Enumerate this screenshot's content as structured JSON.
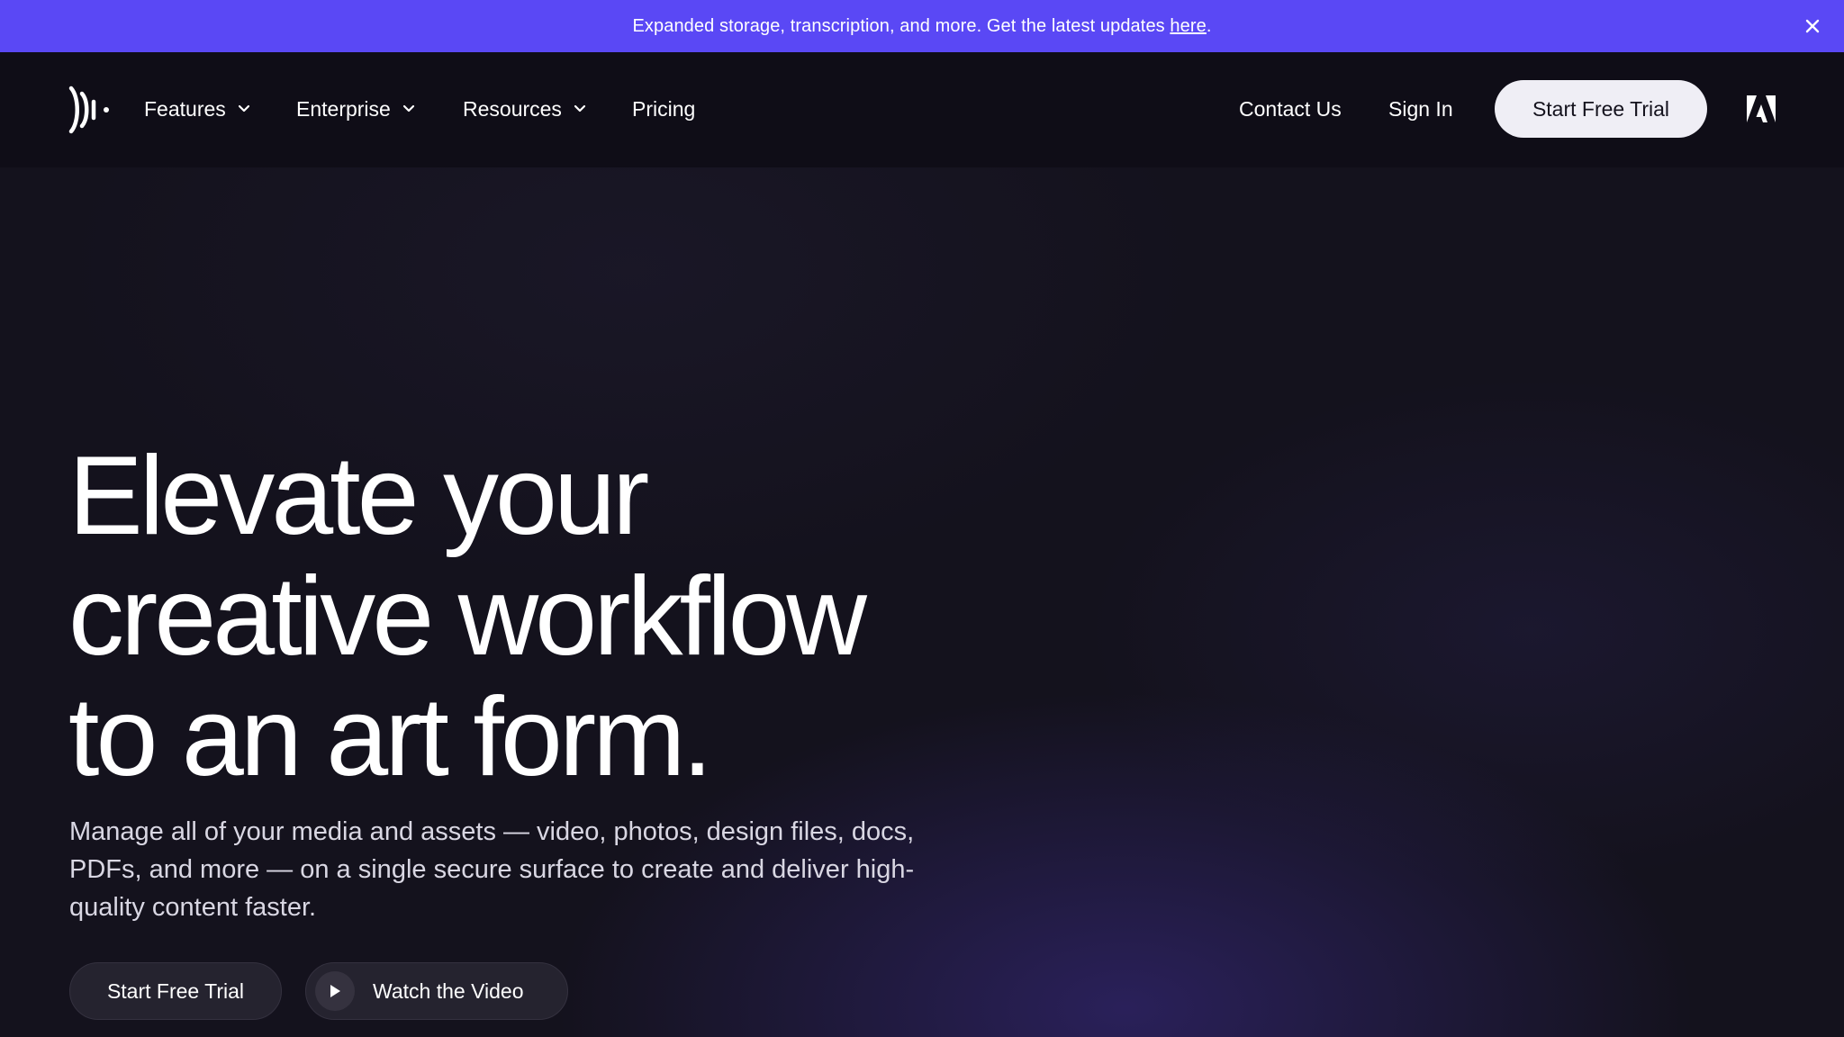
{
  "banner": {
    "message": "Expanded storage, transcription, and more. Get the latest updates ",
    "link_label": "here",
    "suffix": ".",
    "close_icon": "close-icon",
    "background_color": "#5a48f5"
  },
  "nav": {
    "logo_icon": "frameio-logo-icon",
    "items": [
      {
        "label": "Features",
        "has_dropdown": true
      },
      {
        "label": "Enterprise",
        "has_dropdown": true
      },
      {
        "label": "Resources",
        "has_dropdown": true
      },
      {
        "label": "Pricing",
        "has_dropdown": false
      }
    ],
    "contact_label": "Contact Us",
    "signin_label": "Sign In",
    "trial_label": "Start Free Trial",
    "partner_icon": "adobe-logo-icon"
  },
  "hero": {
    "title_lines": [
      "Elevate your",
      "creative workflow",
      "to an art form."
    ],
    "subtitle": "Manage all of your media and assets — video, photos, design files, docs, PDFs, and more — on a single secure surface to create and deliver high-quality content faster.",
    "cta_trial_label": "Start Free Trial",
    "cta_video_label": "Watch the Video",
    "play_icon": "play-icon"
  }
}
